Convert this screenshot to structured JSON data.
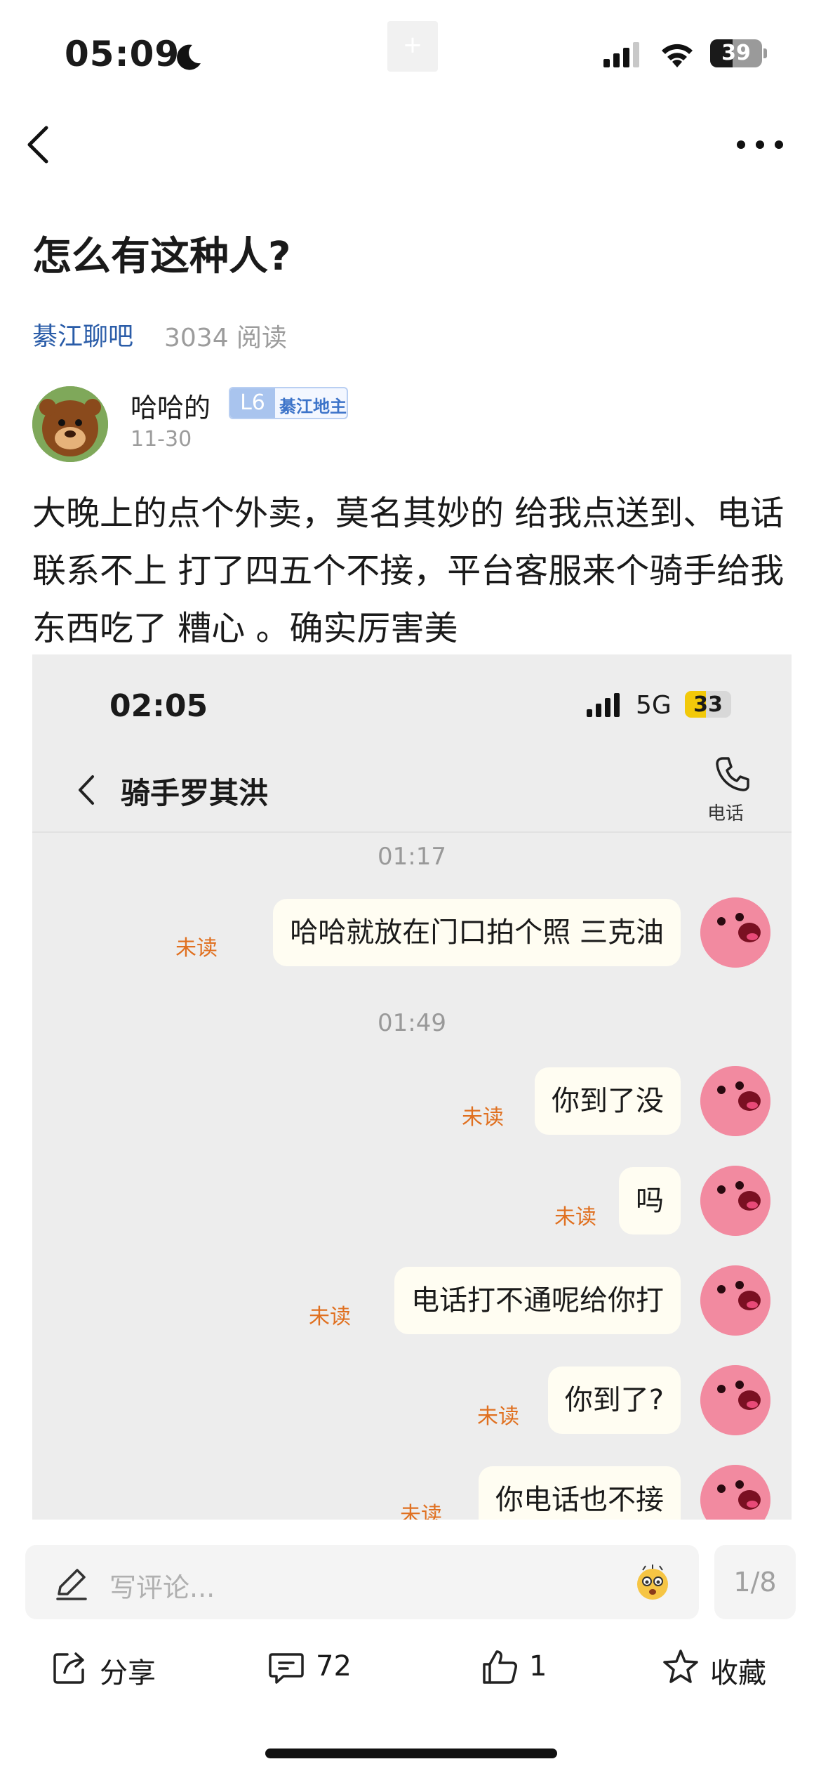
{
  "status_bar": {
    "time": "05:09",
    "center_glyph": "+",
    "battery": "39"
  },
  "post": {
    "title": "怎么有这种人?",
    "forum": "綦江聊吧",
    "read_count": "3034 阅读",
    "author": "哈哈的",
    "level": "L6",
    "level_title": "綦江地主",
    "date": "11-30",
    "body": "大晚上的点个外卖，莫名其妙的 给我点送到、电话联系不上 打了四五个不接，平台客服来个骑手给我东西吃了 糟心 。确实厉害美"
  },
  "embedded_screenshot": {
    "time": "02:05",
    "network": "5G",
    "battery": "33",
    "title": "骑手罗其洪",
    "phone_label": "电话",
    "timestamps": [
      "01:17",
      "01:49"
    ],
    "messages": [
      {
        "text": "哈哈就放在门口拍个照 三克油",
        "status": "未读"
      },
      {
        "text": "你到了没",
        "status": "未读"
      },
      {
        "text": "吗",
        "status": "未读"
      },
      {
        "text": "电话打不通呢给你打",
        "status": "未读"
      },
      {
        "text": "你到了?",
        "status": "未读"
      },
      {
        "text": "你电话也不接",
        "status": "未读"
      }
    ]
  },
  "bottom_bar": {
    "comment_placeholder": "写评论...",
    "page_indicator": "1/8",
    "share_label": "分享",
    "comment_count": "72",
    "like_count": "1",
    "favorite_label": "收藏"
  },
  "icons": [
    "moon-icon",
    "signal-icon",
    "wifi-icon",
    "back-icon",
    "more-icon",
    "phone-icon",
    "pencil-icon",
    "emoji-icon",
    "share-icon",
    "comment-icon",
    "like-icon",
    "star-icon"
  ]
}
